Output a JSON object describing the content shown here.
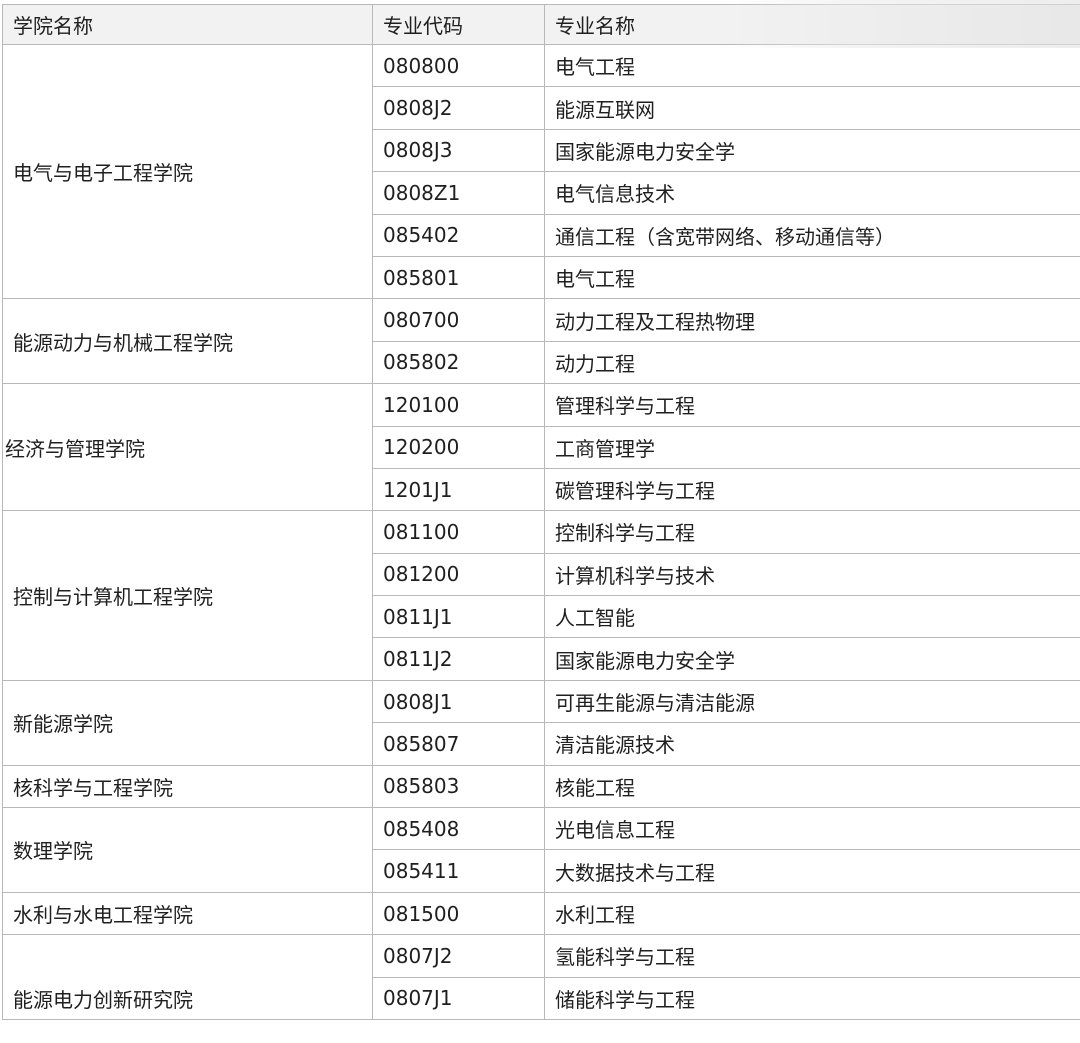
{
  "headers": {
    "college": "学院名称",
    "code": "专业代码",
    "major": "专业名称"
  },
  "groups": [
    {
      "college": "电气与电子工程学院",
      "rows": [
        {
          "code": "080800",
          "major": "电气工程"
        },
        {
          "code": "0808J2",
          "major": "能源互联网"
        },
        {
          "code": "0808J3",
          "major": "国家能源电力安全学"
        },
        {
          "code": "0808Z1",
          "major": "电气信息技术"
        },
        {
          "code": "085402",
          "major": "通信工程（含宽带网络、移动通信等）"
        },
        {
          "code": "085801",
          "major": "电气工程"
        }
      ]
    },
    {
      "college": "能源动力与机械工程学院",
      "rows": [
        {
          "code": "080700",
          "major": "动力工程及工程热物理"
        },
        {
          "code": "085802",
          "major": "动力工程"
        }
      ]
    },
    {
      "college": "经济与管理学院",
      "rows": [
        {
          "code": "120100",
          "major": "管理科学与工程"
        },
        {
          "code": "120200",
          "major": "工商管理学"
        },
        {
          "code": "1201J1",
          "major": "碳管理科学与工程"
        }
      ]
    },
    {
      "college": "控制与计算机工程学院",
      "rows": [
        {
          "code": "081100",
          "major": "控制科学与工程"
        },
        {
          "code": "081200",
          "major": "计算机科学与技术"
        },
        {
          "code": "0811J1",
          "major": "人工智能"
        },
        {
          "code": "0811J2",
          "major": "国家能源电力安全学"
        }
      ]
    },
    {
      "college": "新能源学院",
      "rows": [
        {
          "code": "0808J1",
          "major": "可再生能源与清洁能源"
        },
        {
          "code": "085807",
          "major": "清洁能源技术"
        }
      ]
    },
    {
      "college": "核科学与工程学院",
      "rows": [
        {
          "code": "085803",
          "major": "核能工程"
        }
      ]
    },
    {
      "college": "数理学院",
      "rows": [
        {
          "code": "085408",
          "major": "光电信息工程"
        },
        {
          "code": "085411",
          "major": "大数据技术与工程"
        }
      ]
    },
    {
      "college": "水利与水电工程学院",
      "rows": [
        {
          "code": "081500",
          "major": "水利工程"
        }
      ]
    },
    {
      "college": "能源电力创新研究院",
      "rows": [
        {
          "code": "0807J2",
          "major": "氢能科学与工程"
        },
        {
          "code": "0807J1",
          "major": "储能科学与工程"
        }
      ]
    }
  ]
}
